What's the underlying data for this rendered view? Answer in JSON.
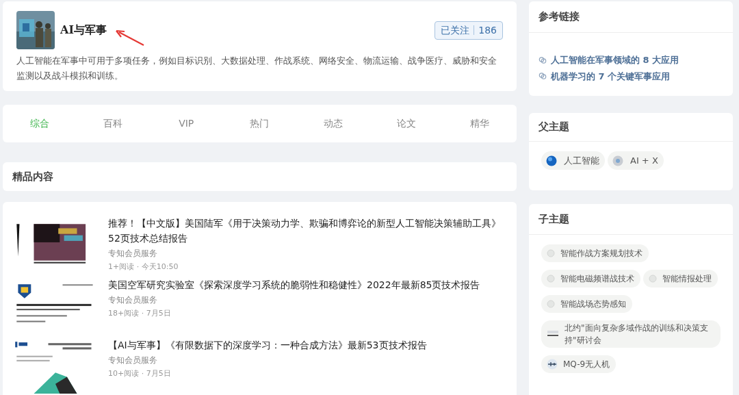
{
  "topic": {
    "title": "AI与军事",
    "follow_button": "已关注",
    "follower_count": "186",
    "followed": true,
    "description": "人工智能在军事中可用于多项任务，例如目标识别、大数据处理、作战系统、网络安全、物流运输、战争医疗、威胁和安全监测以及战斗模拟和训练。"
  },
  "tabs": [
    {
      "label": "综合",
      "selected": true
    },
    {
      "label": "百科",
      "selected": false
    },
    {
      "label": "VIP",
      "selected": false
    },
    {
      "label": "热门",
      "selected": false
    },
    {
      "label": "动态",
      "selected": false
    },
    {
      "label": "论文",
      "selected": false
    },
    {
      "label": "精华",
      "selected": false
    }
  ],
  "featured_section": {
    "title": "精品内容"
  },
  "articles": [
    {
      "title": "推荐！【中文版】美国陆军《用于决策动力学、欺骗和博弈论的新型人工智能决策辅助工具》52页技术总结报告",
      "source": "专知会员服务",
      "meta": "1+阅读 · 今天10:50",
      "kind": "chart"
    },
    {
      "title": "美国空军研究实验室《探索深度学习系统的脆弱性和稳健性》2022年最新85页技术报告",
      "source": "专知会员服务",
      "meta": "18+阅读 · 7月5日",
      "kind": "report"
    },
    {
      "title": "【AI与军事】《有限数据下的深度学习：一种合成方法》最新53页技术报告",
      "source": "专知会员服务",
      "meta": "10+阅读 · 7月5日",
      "kind": "cover"
    }
  ],
  "reference_links": {
    "title": "参考链接",
    "items": [
      "人工智能在军事领域的 8 大应用",
      "机器学习的 7 个关键军事应用"
    ]
  },
  "parent_topics": {
    "title": "父主题",
    "items": [
      {
        "label": "人工智能",
        "kind": "globe"
      },
      {
        "label": "AI + X",
        "kind": "sphere"
      }
    ]
  },
  "child_topics": {
    "title": "子主题",
    "items": [
      {
        "label": "智能作战方案规划技术",
        "kind": "dot"
      },
      {
        "label": "智能电磁频谱战技术",
        "kind": "dot"
      },
      {
        "label": "智能情报处理",
        "kind": "dot"
      },
      {
        "label": "智能战场态势感知",
        "kind": "dot"
      },
      {
        "label": "北约\"面向复杂多域作战的训练和决策支持\"研讨会",
        "kind": "doc"
      },
      {
        "label": "MQ-9无人机",
        "kind": "drone"
      }
    ]
  }
}
